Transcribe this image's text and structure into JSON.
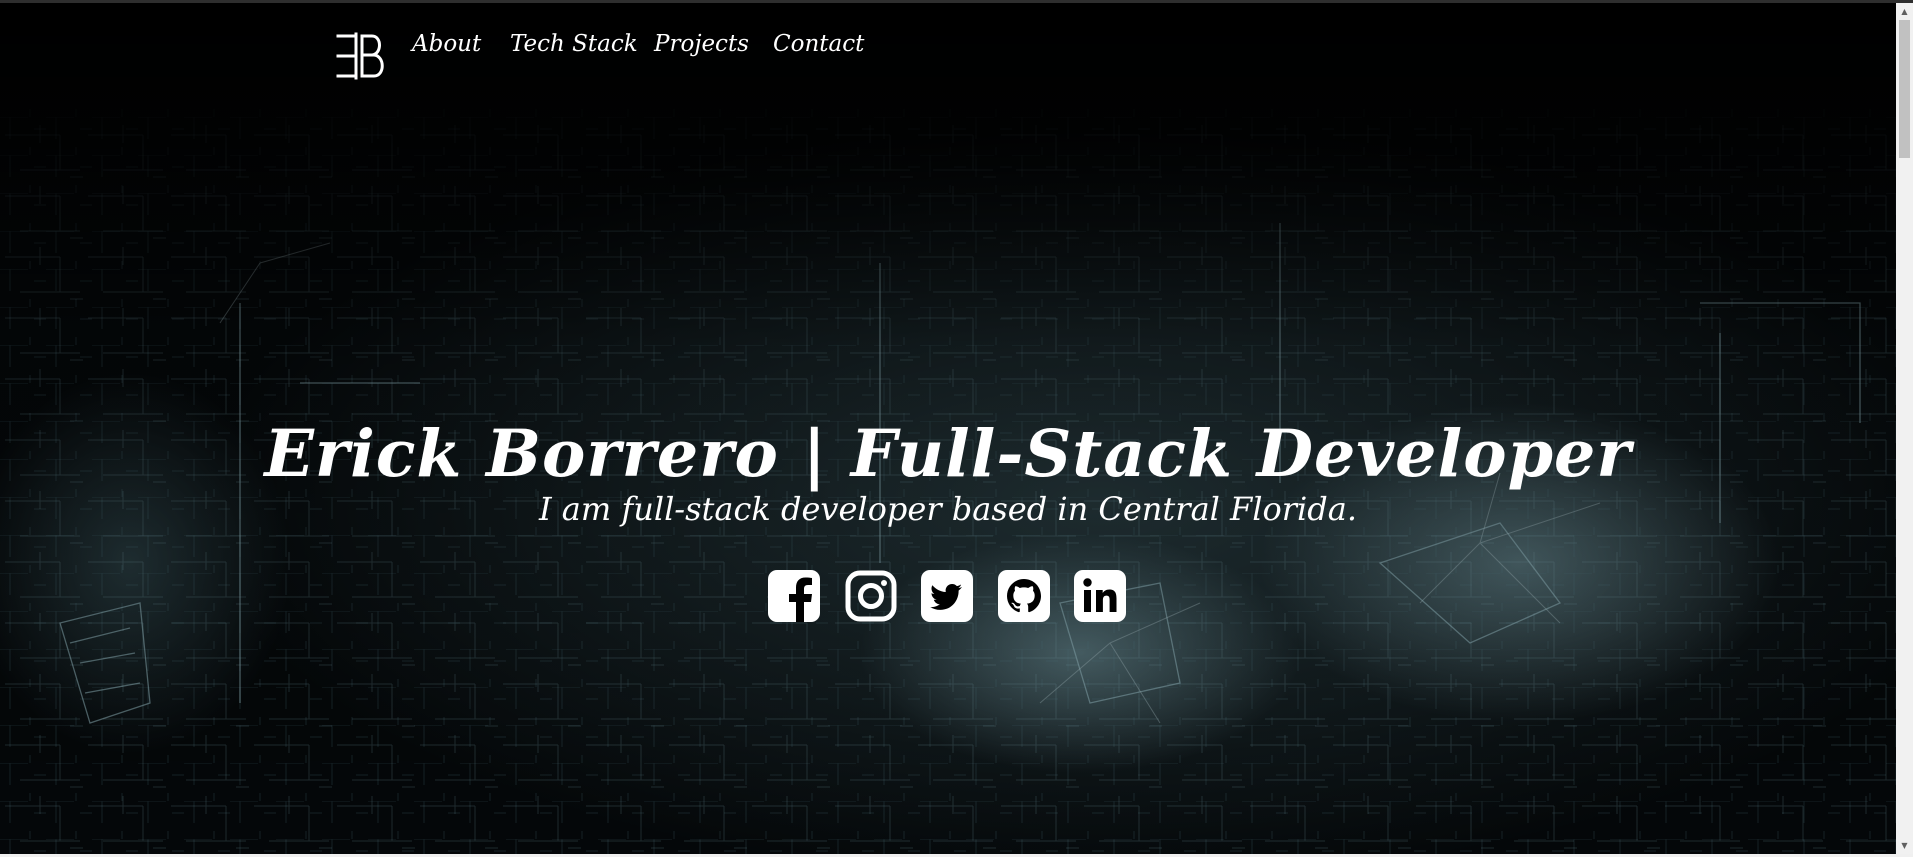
{
  "nav": {
    "logo_alt": "EB",
    "links": [
      {
        "label": "About"
      },
      {
        "label": "Tech Stack"
      },
      {
        "label": "Projects"
      },
      {
        "label": "Contact"
      }
    ]
  },
  "hero": {
    "title": "Erick Borrero | Full-Stack Developer",
    "subtitle": "I am full-stack developer based in Central Florida.",
    "background": "dark digital network / city grid"
  },
  "social": [
    {
      "name": "facebook-icon"
    },
    {
      "name": "instagram-icon"
    },
    {
      "name": "twitter-icon"
    },
    {
      "name": "github-icon"
    },
    {
      "name": "linkedin-icon"
    }
  ],
  "scrollbar": {
    "up_glyph": "▲",
    "down_glyph": "▼"
  },
  "colors": {
    "background": "#000000",
    "text": "#ffffff",
    "network_accent": "#7fb7c4"
  }
}
